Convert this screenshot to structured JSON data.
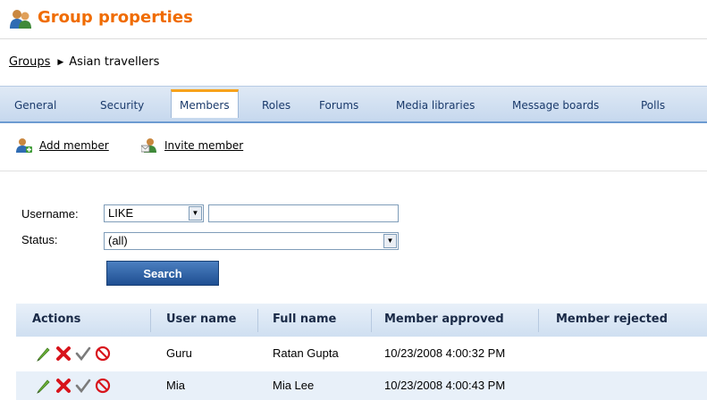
{
  "header": {
    "title": "Group properties",
    "icon": "users-group-icon"
  },
  "breadcrumb": {
    "parent": "Groups",
    "current": "Asian travellers"
  },
  "tabs": [
    {
      "label": "General"
    },
    {
      "label": "Security"
    },
    {
      "label": "Members",
      "active": true
    },
    {
      "label": "Roles"
    },
    {
      "label": "Forums"
    },
    {
      "label": "Media libraries"
    },
    {
      "label": "Message boards"
    },
    {
      "label": "Polls"
    }
  ],
  "actions": {
    "add_member": "Add member",
    "invite_member": "Invite member"
  },
  "filter": {
    "username_label": "Username:",
    "username_operator": "LIKE",
    "username_value": "",
    "status_label": "Status:",
    "status_value": "(all)",
    "search_label": "Search"
  },
  "grid": {
    "columns": [
      "Actions",
      "User name",
      "Full name",
      "Member approved",
      "Member rejected"
    ],
    "rows": [
      {
        "user_name": "Guru",
        "full_name": "Ratan Gupta",
        "approved": "10/23/2008 4:00:32 PM",
        "rejected": ""
      },
      {
        "user_name": "Mia",
        "full_name": "Mia Lee",
        "approved": "10/23/2008 4:00:43 PM",
        "rejected": ""
      }
    ]
  },
  "colors": {
    "title": "#f06c00",
    "tab_accent": "#f7a21b",
    "tabbar": "#c6d8ee",
    "row_alt": "#e8f0f9"
  }
}
